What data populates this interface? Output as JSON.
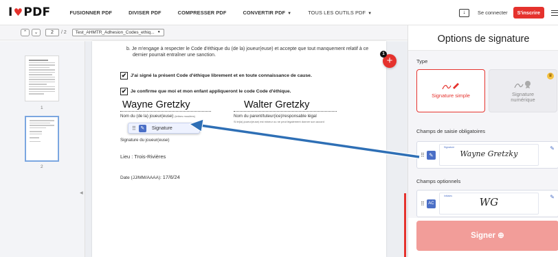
{
  "brand": {
    "logo_pre": "I",
    "logo_post": "PDF",
    "accent": "#e5322d"
  },
  "nav": [
    {
      "label": "FUSIONNER PDF"
    },
    {
      "label": "DIVISER PDF"
    },
    {
      "label": "COMPRESSER PDF"
    },
    {
      "label": "CONVERTIR PDF",
      "caret": "▼"
    },
    {
      "label": "TOUS LES OUTILS PDF",
      "caret": "▼"
    }
  ],
  "header": {
    "login": "Se connecter",
    "signup": "S'inscrire"
  },
  "toolbar": {
    "page_current": "2",
    "page_total": "/ 2",
    "file_name": "Test_AHMTR_Adhesion_Codes_ethiq..."
  },
  "thumbnails": [
    {
      "num": "1"
    },
    {
      "num": "2"
    }
  ],
  "document": {
    "clause_line1": "b. Je m'engage à respecter le Code d'éthique du (de la) joueur(euse) et accepte que tout manquement relatif à ce",
    "clause_line2": "dernier pourrait entraîner une sanction.",
    "check1": "J'ai signé la présent Code d'éthique librement et en toute connaissance de cause.",
    "check2": "Je confirme que moi et mon enfant appliqueront le code Code d'éthique.",
    "player_name": "Wayne Gretzky",
    "parent_name": "Walter Gretzky",
    "player_label": "Nom du (de la) joueur(euse)",
    "player_label_small": "(lettres moulées)",
    "parent_label": "Nom du parent/tuteur(ice)/responsable légal",
    "parent_note": "Si le(la) joueur(euse) est mineur ou ne peut légalement donner son accord",
    "signature_chip": "Signature",
    "signature_label": "Signature du joueur(euse)",
    "place_label": "Lieu : ",
    "place_value": "Trois-Rivières",
    "date_label": "Date (JJ/MM/AAAA): ",
    "date_value": "17/6/24",
    "badge": "1",
    "add": "+"
  },
  "panel": {
    "title": "Options de signature",
    "type_label": "Type",
    "type_simple": "Signature simple",
    "type_digital_1": "Signature",
    "type_digital_2": "numérique",
    "required_label": "Champs de saisie obligatoires",
    "required_field": {
      "tag": "Signature",
      "value": "Wayne Gretzky"
    },
    "optional_label": "Champs optionnels",
    "optional_field": {
      "tag": "Initiales",
      "value": "WG"
    },
    "sign_button": "Signer",
    "sign_icon": "⊕"
  },
  "colors": {
    "accent": "#e5322d",
    "field_icon": "#4b6fc6",
    "arrow": "#2e6fb5",
    "sign_disabled": "#f29d99"
  }
}
